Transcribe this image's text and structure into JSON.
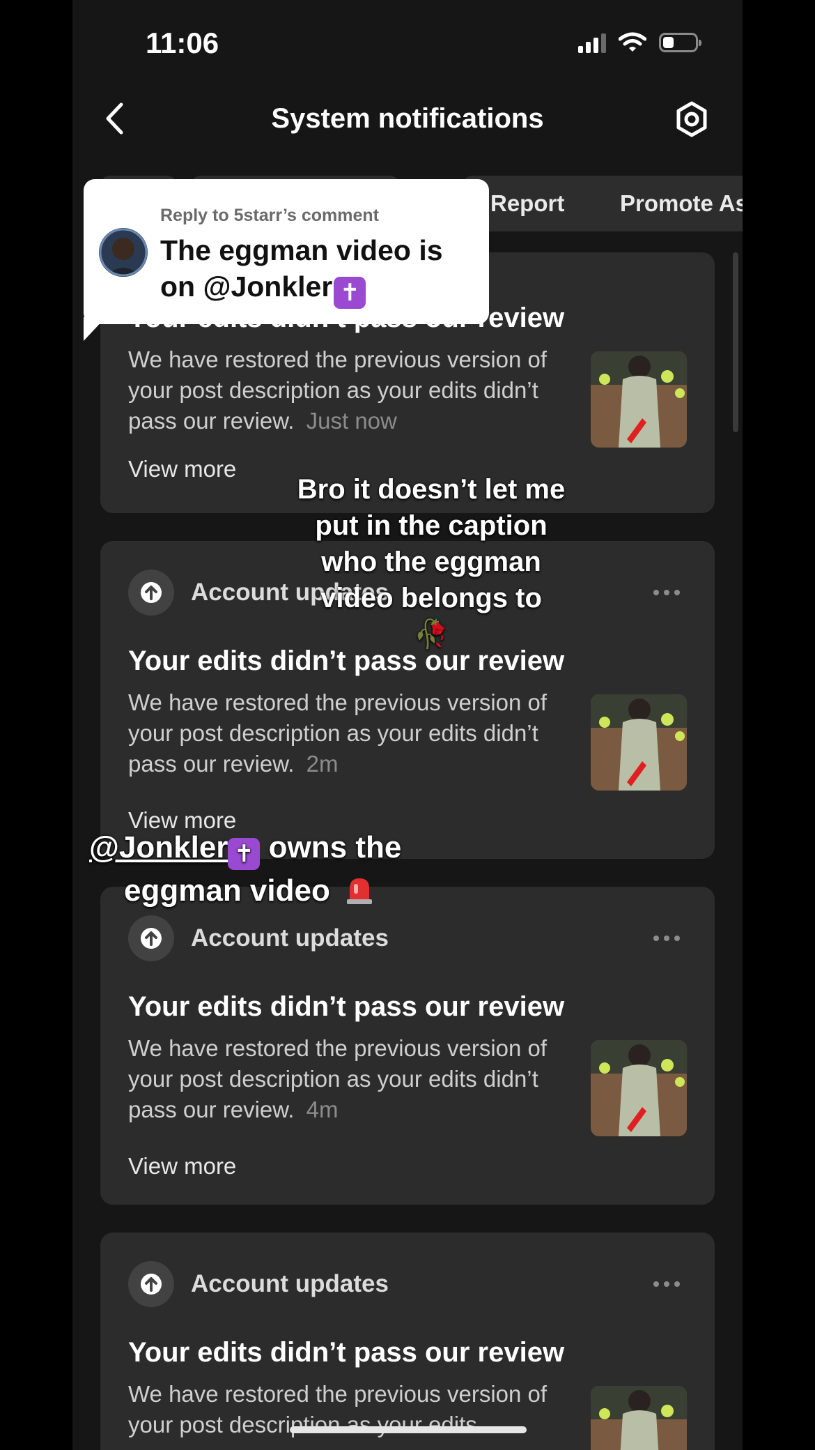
{
  "status_bar": {
    "time": "11:06",
    "battery_fraction": 0.35
  },
  "header": {
    "title": "System notifications"
  },
  "filter_chips": [
    {
      "label": ""
    },
    {
      "label": ""
    },
    {
      "label": "Report"
    },
    {
      "label": "Promote As"
    }
  ],
  "reply_bubble": {
    "subtitle": "Reply to 5starr’s comment",
    "text": "The eggman video is on @Jonkler",
    "badge": "✝"
  },
  "overlay_captions": {
    "caption_1": "Bro it doesn’t let me put in the caption who the eggman video belongs to",
    "caption_1_emoji": "🥀",
    "caption_2_mention": "@Jonkler",
    "caption_2_badge": "✝",
    "caption_2_rest_1": " owns the",
    "caption_2_rest_2": "eggman video",
    "caption_2_emoji": "🚨"
  },
  "notifications": [
    {
      "category": "",
      "title": "Your edits didn’t pass our review",
      "description": "We have restored the previous version of your post description as your edits didn’t pass our review.",
      "time": "Just now",
      "view_more": "View more"
    },
    {
      "category": "Account updates",
      "title": "Your edits didn’t pass our review",
      "description": "We have restored the previous version of your post description as your edits didn’t pass our review.",
      "time": "2m",
      "view_more": "View more"
    },
    {
      "category": "Account updates",
      "title": "Your edits didn’t pass our review",
      "description": "We have restored the previous version of your post description as your edits didn’t pass our review.",
      "time": "4m",
      "view_more": "View more"
    },
    {
      "category": "Account updates",
      "title": "Your edits didn’t pass our review",
      "description": "We have restored the previous version of your post description as your edits",
      "time": "",
      "view_more": ""
    }
  ],
  "icons": {
    "back": "chevron-left-icon",
    "settings": "gear-icon",
    "category": "arrow-up-circle-icon",
    "more": "more-dots-icon"
  },
  "colors": {
    "background": "#161616",
    "card": "#2c2c2c",
    "chip": "#2d2d2d",
    "badge": "#9a4ad0",
    "siren": "#e23030"
  }
}
